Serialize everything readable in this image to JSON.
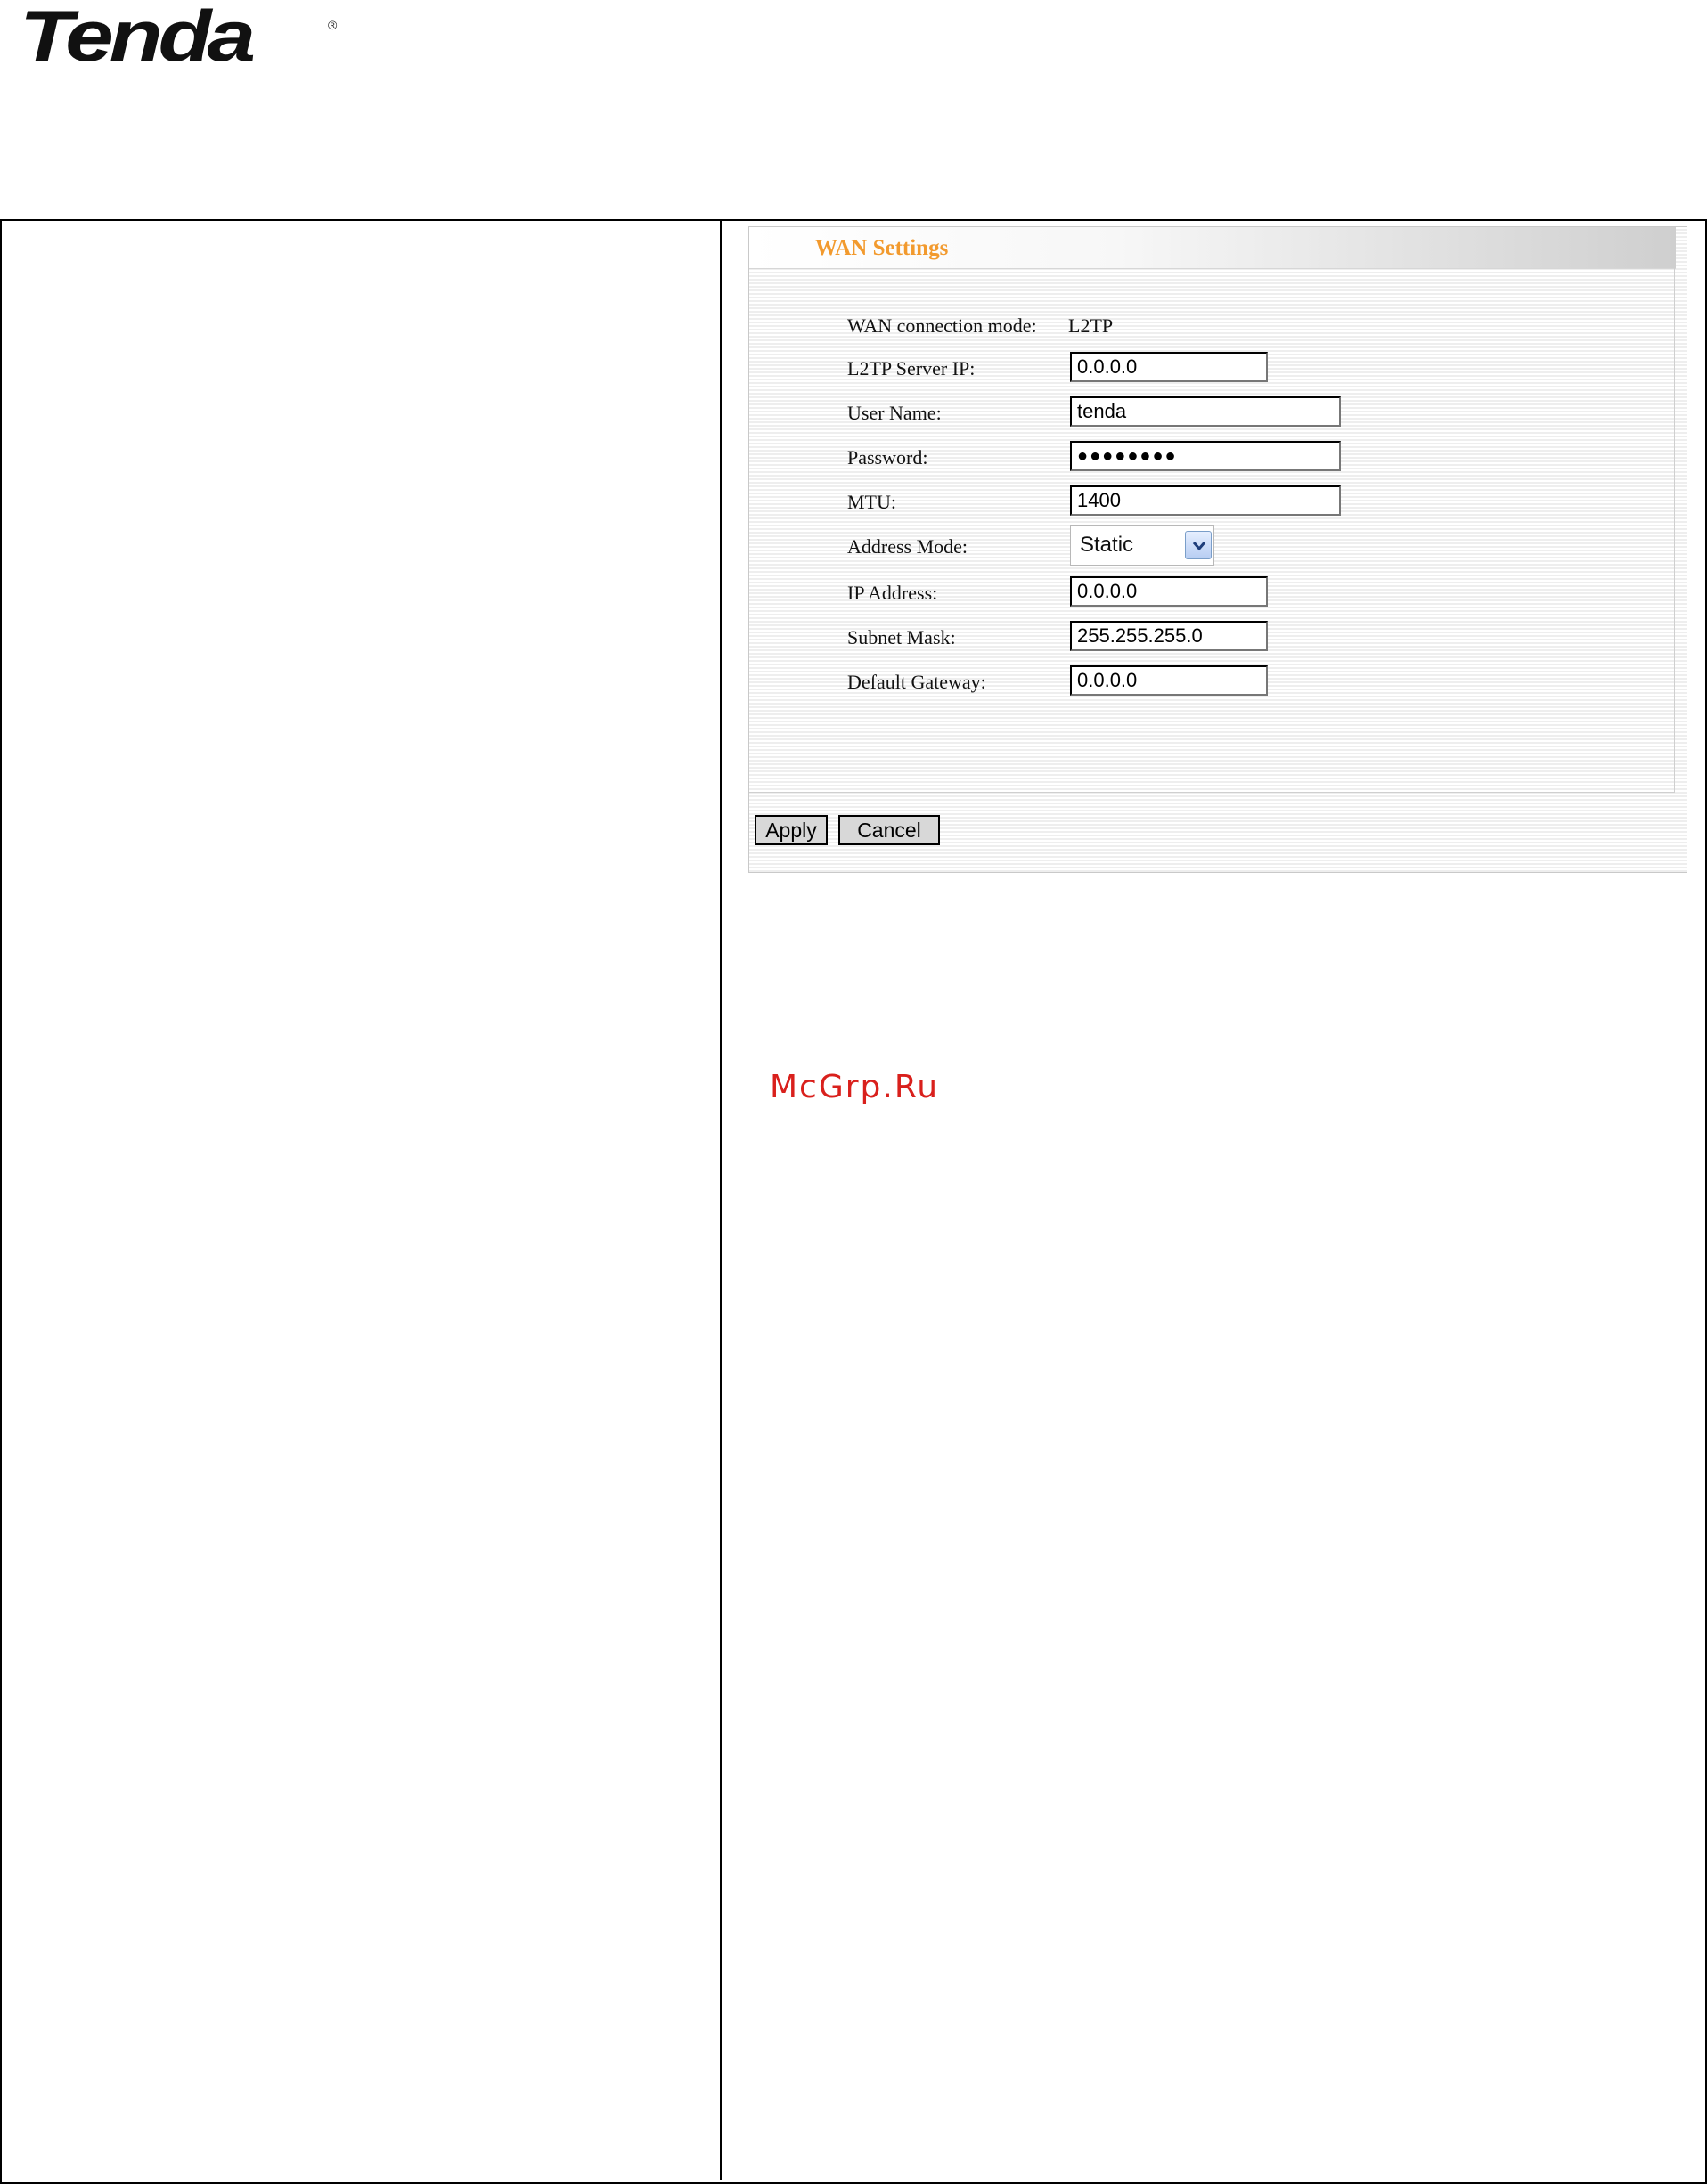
{
  "header": {
    "logo_text": "Tenda",
    "logo_mark": "®"
  },
  "wan_panel": {
    "title": "WAN Settings",
    "connection_mode_label": "WAN connection mode:",
    "connection_mode_value": "L2TP",
    "fields": {
      "server_ip": {
        "label": "L2TP Server IP:",
        "value": "0.0.0.0"
      },
      "user_name": {
        "label": "User Name:",
        "value": "tenda"
      },
      "password": {
        "label": "Password:",
        "value": "●●●●●●●●"
      },
      "mtu": {
        "label": "MTU:",
        "value": "1400"
      },
      "address_mode": {
        "label": "Address Mode:",
        "value": "Static"
      },
      "ip_address": {
        "label": "IP Address:",
        "value": "0.0.0.0"
      },
      "subnet_mask": {
        "label": "Subnet Mask:",
        "value": "255.255.255.0"
      },
      "default_gateway": {
        "label": "Default Gateway:",
        "value": "0.0.0.0"
      }
    },
    "buttons": {
      "apply": "Apply",
      "cancel": "Cancel"
    }
  },
  "watermark": "McGrp.Ru",
  "colors": {
    "title_orange": "#f29a2e",
    "watermark_red": "#d9201c"
  }
}
